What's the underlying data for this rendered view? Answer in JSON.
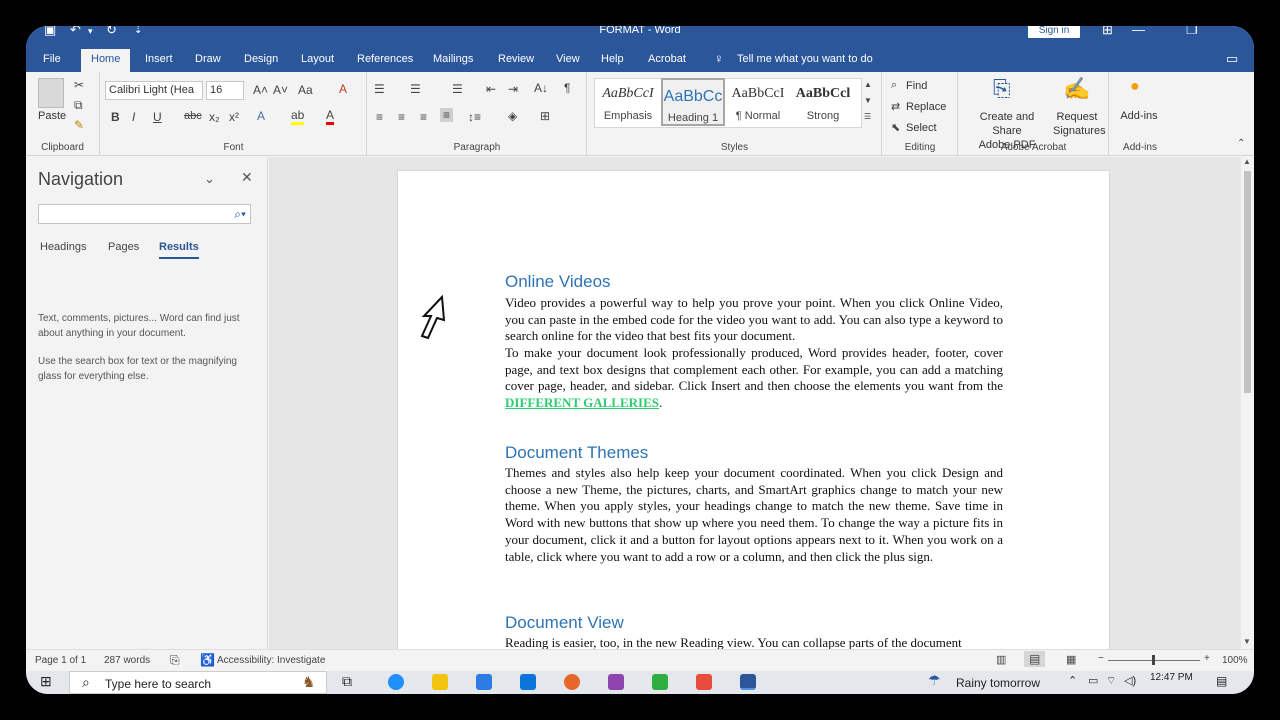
{
  "window": {
    "title": "FORMAT - Word",
    "signin": "Sign in"
  },
  "tabs": [
    "File",
    "Home",
    "Insert",
    "Draw",
    "Design",
    "Layout",
    "References",
    "Mailings",
    "Review",
    "View",
    "Help",
    "Acrobat"
  ],
  "tell_me": "Tell me what you want to do",
  "ribbon": {
    "clipboard": {
      "paste": "Paste",
      "label": "Clipboard"
    },
    "font": {
      "name": "Calibri Light (Hea",
      "size": "16",
      "label": "Font"
    },
    "paragraph": {
      "label": "Paragraph"
    },
    "styles": {
      "label": "Styles",
      "items": [
        {
          "sample": "AaBbCcI",
          "name": "Emphasis"
        },
        {
          "sample": "AaBbCc",
          "name": "Heading 1"
        },
        {
          "sample": "AaBbCcI",
          "name": "¶ Normal"
        },
        {
          "sample": "AaBbCcl",
          "name": "Strong"
        }
      ]
    },
    "editing": {
      "find": "Find",
      "replace": "Replace",
      "select": "Select",
      "label": "Editing"
    },
    "acrobat": {
      "create": "Create and Share",
      "create2": "Adobe PDF",
      "request": "Request",
      "request2": "Signatures",
      "label": "Adobe Acrobat"
    },
    "addins": {
      "button": "Add-ins",
      "label": "Add-ins"
    }
  },
  "navigation": {
    "title": "Navigation",
    "tabs": [
      "Headings",
      "Pages",
      "Results"
    ],
    "active_tab": "Results",
    "text1": "Text, comments, pictures... Word can find just about anything in your document.",
    "text2": "Use the search box for text or the magnifying glass for everything else."
  },
  "document": {
    "h1": "Online Videos",
    "p1": "Video provides a powerful way to help you prove your point. When you click Online Video, you can paste in the embed code for the video you want to add. You can also type a keyword to search online for the video that best fits your document.",
    "p2": "To make your document look professionally produced, Word provides header, footer, cover page, and text box designs that complement each other. For example, you can add a matching cover page, header, and sidebar. Click Insert and then choose the elements you want from the",
    "p2_link": "DIFFERENT GALLERIES",
    "h2": "Document Themes",
    "p3": "Themes and styles also help keep your document coordinated. When you click Design and choose a new Theme, the pictures, charts, and SmartArt graphics change to match your new theme. When you apply styles, your headings change to match the new theme. Save time in Word with new buttons that show up where you need them. To change the way a picture fits in your document, click it and a button for layout options appears next to it. When you work on a table, click where you want to add a row or a column, and then click the plus sign.",
    "h3": "Document View",
    "p4": "Reading is easier, too, in the new Reading view. You can collapse parts of the document"
  },
  "status": {
    "page": "Page 1 of 1",
    "words": "287 words",
    "accessibility": "Accessibility: Investigate",
    "zoom": "100%"
  },
  "taskbar": {
    "search": "Type here to search",
    "weather": "Rainy tomorrow",
    "time": "12:47 PM"
  }
}
